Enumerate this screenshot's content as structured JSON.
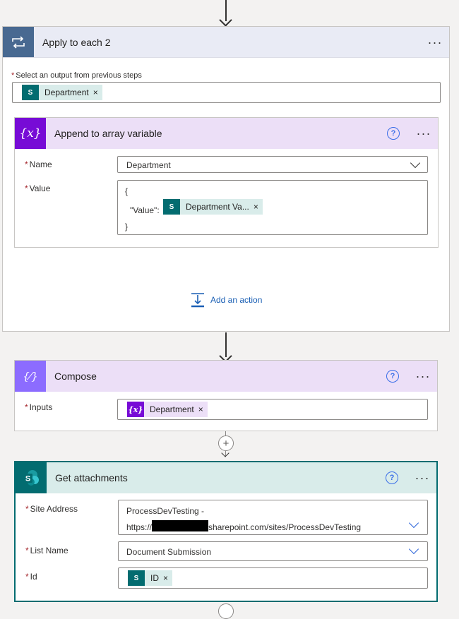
{
  "apply_each": {
    "title": "Apply to each 2",
    "more": "···",
    "select_label": "Select an output from previous steps",
    "required_mark": "*",
    "token": "Department",
    "token_x": "×",
    "add_action": "Add an action"
  },
  "append": {
    "title": "Append to array variable",
    "help": "?",
    "more": "···",
    "name_label": "Name",
    "name_value": "Department",
    "value_label": "Value",
    "brace_open": "{",
    "value_key": "\"Value\":",
    "value_token": "Department Va...",
    "token_x": "×",
    "brace_close": "}"
  },
  "compose": {
    "title": "Compose",
    "help": "?",
    "more": "···",
    "inputs_label": "Inputs",
    "token": "Department",
    "token_x": "×"
  },
  "get_attachments": {
    "title": "Get attachments",
    "help": "?",
    "more": "···",
    "site_label": "Site Address",
    "site_line1": "ProcessDevTesting -",
    "site_prefix": "https://",
    "site_suffix": "sharepoint.com/sites/ProcessDevTesting",
    "list_label": "List Name",
    "list_value": "Document Submission",
    "id_label": "Id",
    "id_token": "ID",
    "token_x": "×"
  },
  "icons": {
    "loop": "loop-icon",
    "variable": "variable-icon",
    "compose": "compose-icon",
    "sharepoint": "sharepoint-icon"
  },
  "colors": {
    "loop_header": "#e9ebf5",
    "loop_icon": "#486991",
    "variable_header": "#ecdff7",
    "variable_icon": "#770bd6",
    "compose_icon": "#8c6cff",
    "sharepoint_header": "#d9ecea",
    "sharepoint_icon": "#036c70",
    "link_blue": "#1a5fb4"
  }
}
